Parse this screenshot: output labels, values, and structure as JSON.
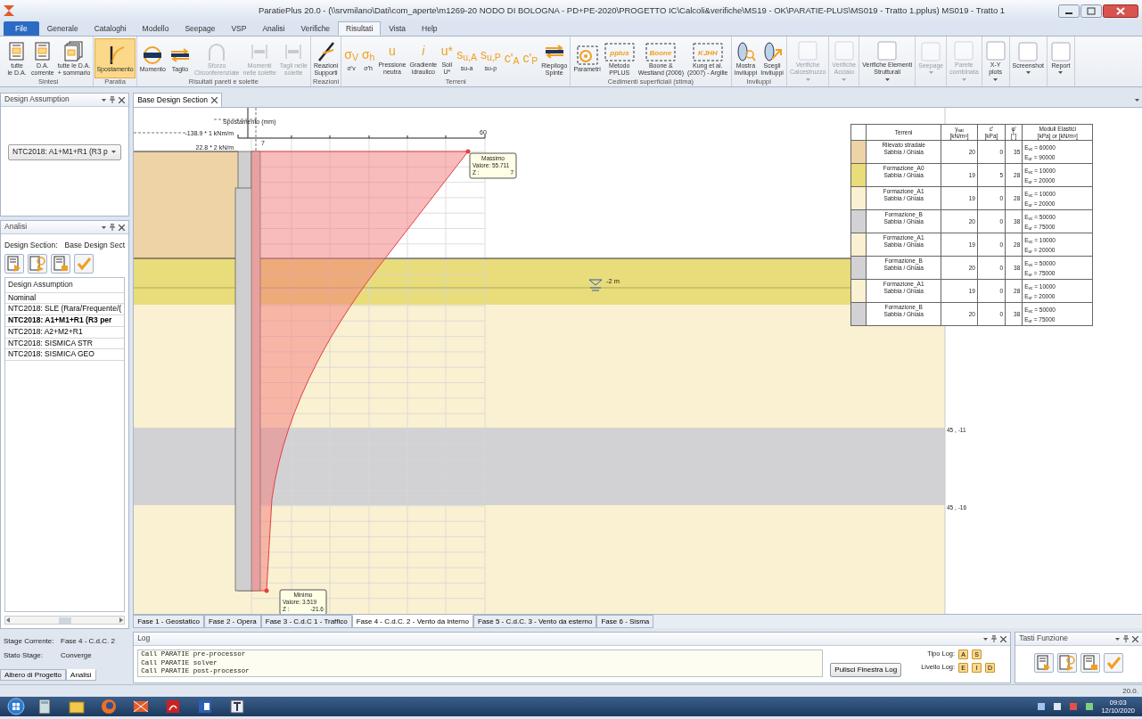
{
  "window": {
    "title": "ParatiePlus 20.0 - (\\\\srvmilano\\Dati\\com_aperte\\m1269-20 NODO DI BOLOGNA - PD+PE-2020\\PROGETTO IC\\Calcoli&verifiche\\MS19 - OK\\PARATIE-PLUS\\MS019 - Tratto 1.pplus) MS019 - Tratto 1"
  },
  "menu_tabs": [
    {
      "label": "File",
      "kind": "file",
      "selected": false
    },
    {
      "label": "Generale",
      "kind": "tab",
      "selected": false
    },
    {
      "label": "Cataloghi",
      "kind": "tab",
      "selected": false
    },
    {
      "label": "Modello",
      "kind": "tab",
      "selected": false
    },
    {
      "label": "Seepage",
      "kind": "tab",
      "selected": false
    },
    {
      "label": "VSP",
      "kind": "tab",
      "selected": false
    },
    {
      "label": "Analisi",
      "kind": "tab",
      "selected": false
    },
    {
      "label": "Verifiche",
      "kind": "tab",
      "selected": false
    },
    {
      "label": "Risultati",
      "kind": "tab",
      "selected": true
    },
    {
      "label": "Vista",
      "kind": "tab",
      "selected": false
    },
    {
      "label": "Help",
      "kind": "tab",
      "selected": false
    }
  ],
  "ribbon": {
    "groups": [
      {
        "label": "Sintesi",
        "buttons": [
          {
            "label": "tutte\nle D.A.",
            "kind": "icon",
            "selected": false,
            "disabled": false
          },
          {
            "label": "D.A.\ncorrente",
            "kind": "icon",
            "selected": false,
            "disabled": false
          },
          {
            "label": "tutte le D.A.\n+ sommario",
            "kind": "icon",
            "selected": false,
            "disabled": false
          }
        ]
      },
      {
        "label": "Paratia",
        "buttons": [
          {
            "label": "Spostamento",
            "kind": "icon",
            "selected": true,
            "disabled": false
          }
        ]
      },
      {
        "label": "Risultati pareti e solette",
        "buttons": [
          {
            "label": "Momento",
            "kind": "icon",
            "selected": false,
            "disabled": false
          },
          {
            "label": "Taglio",
            "kind": "icon",
            "selected": false,
            "disabled": false
          },
          {
            "label": "Sforzo\nCirconferenziale",
            "kind": "icon",
            "selected": false,
            "disabled": true
          },
          {
            "label": "Momenti\nnelle solette",
            "kind": "icon",
            "selected": false,
            "disabled": true
          },
          {
            "label": "Tagli nelle\nsolette",
            "kind": "icon",
            "selected": false,
            "disabled": true
          }
        ]
      },
      {
        "label": "Reazioni",
        "buttons": [
          {
            "label": "Reazioni\nSupporti",
            "kind": "icon",
            "selected": false,
            "disabled": false
          }
        ]
      },
      {
        "label": "Terreni",
        "buttons": [
          {
            "label": "σ'v",
            "kind": "glyph",
            "glyph": "σ$_{V}$",
            "selected": false,
            "disabled": false
          },
          {
            "label": "σ'h",
            "kind": "glyph",
            "glyph": "σ$_{h}$",
            "selected": false,
            "disabled": false
          },
          {
            "label": "Pressione\nneutra",
            "kind": "glyph",
            "glyph": "u",
            "selected": false,
            "disabled": false
          },
          {
            "label": "Gradiente\nidraulico",
            "kind": "glyph",
            "glyph": "*i*",
            "selected": false,
            "disabled": false
          },
          {
            "label": "Soil\nU*",
            "kind": "glyph",
            "glyph": "u*",
            "selected": false,
            "disabled": false
          },
          {
            "label": "su-a",
            "kind": "glyph",
            "glyph": "s$_{u,A}$",
            "selected": false,
            "disabled": false
          },
          {
            "label": "su-p",
            "kind": "glyph",
            "glyph": "s$_{u,P}$",
            "selected": false,
            "disabled": false
          },
          {
            "kind": "glyph",
            "glyph": "c'$_{A}$",
            "selected": false,
            "disabled": false
          },
          {
            "kind": "glyph",
            "glyph": "c'$_{P}$",
            "selected": false,
            "disabled": false
          },
          {
            "label": "Riepilogo\nSpinte",
            "kind": "icon",
            "selected": false,
            "disabled": false
          }
        ]
      },
      {
        "label": "Cedimenti superficiali (stima)",
        "buttons": [
          {
            "label": "Parametri",
            "kind": "icon",
            "selected": false,
            "disabled": false
          },
          {
            "label": "Metodo\nPPLUS",
            "kind": "logo",
            "icon_text": "pplus",
            "selected": false,
            "disabled": false
          },
          {
            "label": "Boone &\nWestland (2006)",
            "kind": "logo",
            "icon_text": "Boone",
            "selected": false,
            "disabled": false
          },
          {
            "label": "Kung et al.\n(2007) - Argille",
            "kind": "logo",
            "icon_text": "KJHH",
            "selected": false,
            "disabled": false
          }
        ]
      },
      {
        "label": "Inviluppi",
        "buttons": [
          {
            "label": "Mostra\nInviluppi",
            "kind": "icon",
            "selected": false,
            "disabled": false
          },
          {
            "label": "Scegli\nInviluppi",
            "kind": "icon",
            "selected": false,
            "disabled": false
          }
        ]
      },
      {
        "buttons": [
          {
            "label": "Verifiche\nCalcestruzzo",
            "kind": "icon",
            "dropdown": true,
            "selected": false,
            "disabled": true
          }
        ]
      },
      {
        "buttons": [
          {
            "label": "Verifiche\nAcciaio",
            "kind": "icon",
            "dropdown": true,
            "selected": false,
            "disabled": true
          }
        ]
      },
      {
        "buttons": [
          {
            "label": "Verifiche Elementi\nStrutturali",
            "kind": "icon",
            "dropdown": true,
            "selected": false,
            "disabled": false
          }
        ]
      },
      {
        "buttons": [
          {
            "label": "Seepage",
            "kind": "icon",
            "dropdown": true,
            "selected": false,
            "disabled": true
          }
        ]
      },
      {
        "buttons": [
          {
            "label": "Parete\ncombinata",
            "kind": "icon",
            "dropdown": true,
            "selected": false,
            "disabled": true
          }
        ]
      },
      {
        "buttons": [
          {
            "label": "X-Y\nplots",
            "kind": "icon",
            "dropdown": true,
            "selected": false,
            "disabled": false
          }
        ]
      },
      {
        "buttons": [
          {
            "label": "Screenshot",
            "kind": "icon",
            "dropdown": true,
            "selected": false,
            "disabled": false
          }
        ]
      },
      {
        "buttons": [
          {
            "label": "Report",
            "kind": "icon",
            "dropdown": true,
            "selected": false,
            "disabled": false
          }
        ]
      }
    ]
  },
  "design_assumption_panel": {
    "title": "Design Assumption",
    "dropdown": "NTC2018: A1+M1+R1 (R3 p"
  },
  "analysis_panel": {
    "title": "Analisi",
    "section_label": "Design Section:",
    "section_value": "Base Design Sect",
    "list_header": "Design Assumption",
    "items": [
      {
        "label": "Nominal",
        "selected": false
      },
      {
        "label": "NTC2018: SLE (Rara/Frequente/(",
        "selected": false
      },
      {
        "label": "NTC2018: A1+M1+R1 (R3 per",
        "selected": true
      },
      {
        "label": "NTC2018: A2+M2+R1",
        "selected": false
      },
      {
        "label": "NTC2018: SISMICA STR",
        "selected": false
      },
      {
        "label": "NTC2018: SISMICA GEO",
        "selected": false
      }
    ]
  },
  "stage": {
    "current_label": "Stage Corrente:",
    "current_value": "Fase 4 - C.d.C. 2",
    "state_label": "Stato Stage:",
    "state_value": "Converge"
  },
  "left_tabs": [
    {
      "label": "Albero di Progetto",
      "selected": false
    },
    {
      "label": "Analisi",
      "selected": true
    }
  ],
  "document": {
    "tabs": [
      {
        "label": "Base Design Section",
        "selected": true
      }
    ],
    "drawing": {
      "axis_title": "Spostamento (mm)",
      "moment_label": "-138.9 * 1 kNm/m",
      "force_label": "22.8 * 2 kN/m",
      "tick_label": "60",
      "top_value": "7",
      "max_box": {
        "title": "Massimo",
        "value": "Valore: 55.711",
        "z_label": "Z :",
        "z_value": "7"
      },
      "min_box": {
        "title": "Minimo",
        "value": "Valore: 3.519",
        "z_label": "Z :",
        "z_value": "-21.6"
      },
      "water_level": "-2 m",
      "coordinates": [
        "45 , -11",
        "45 , -16"
      ]
    },
    "legend": {
      "columns": [
        {
          "title": "Terreni"
        },
        {
          "title": "γ$_{sat}$",
          "unit": "[kN/m³]"
        },
        {
          "title": "c'",
          "unit": "[kPa]"
        },
        {
          "title": "φ'",
          "unit": "[°]"
        },
        {
          "title": "Moduli Elastici",
          "unit": "[kPa] or [kN/m³]"
        }
      ],
      "rows": [
        {
          "name": "Rilevato stradale",
          "type": "Sabbia / Ghiaia",
          "color": "#eed3a6",
          "gamma": "20",
          "c": "0",
          "phi": "35",
          "evc": "E$_{vc}$ = 60000",
          "eur": "E$_{ur}$ = 90000"
        },
        {
          "name": "Formazione_A0",
          "type": "Sabbia / Ghiaia",
          "color": "#e9dc7a",
          "gamma": "19",
          "c": "5",
          "phi": "28",
          "evc": "E$_{vc}$ = 10000",
          "eur": "E$_{ur}$ = 20000"
        },
        {
          "name": "Formazione_A1",
          "type": "Sabbia / Ghiaia",
          "color": "#faf1d2",
          "gamma": "19",
          "c": "0",
          "phi": "28",
          "evc": "E$_{vc}$ = 10000",
          "eur": "E$_{ur}$ = 20000"
        },
        {
          "name": "Formazione_B",
          "type": "Sabbia / Ghiaia",
          "color": "#d2d2d4",
          "gamma": "20",
          "c": "0",
          "phi": "38",
          "evc": "E$_{vc}$ = 50000",
          "eur": "E$_{ur}$ = 75000"
        },
        {
          "name": "Formazione_A1",
          "type": "Sabbia / Ghiaia",
          "color": "#faf1d2",
          "gamma": "19",
          "c": "0",
          "phi": "28",
          "evc": "E$_{vc}$ = 10000",
          "eur": "E$_{ur}$ = 20000"
        },
        {
          "name": "Formazione_B",
          "type": "Sabbia / Ghiaia",
          "color": "#d2d2d4",
          "gamma": "20",
          "c": "0",
          "phi": "38",
          "evc": "E$_{vc}$ = 50000",
          "eur": "E$_{ur}$ = 75000"
        },
        {
          "name": "Formazione_A1",
          "type": "Sabbia / Ghiaia",
          "color": "#faf1d2",
          "gamma": "19",
          "c": "0",
          "phi": "28",
          "evc": "E$_{vc}$ = 10000",
          "eur": "E$_{ur}$ = 20000"
        },
        {
          "name": "Formazione_B",
          "type": "Sabbia / Ghiaia",
          "color": "#d2d2d4",
          "gamma": "20",
          "c": "0",
          "phi": "38",
          "evc": "E$_{vc}$ = 50000",
          "eur": "E$_{ur}$ = 75000"
        }
      ]
    },
    "phase_tabs": [
      {
        "label": "Fase 1 - Geostatico",
        "selected": false
      },
      {
        "label": "Fase 2 - Opera",
        "selected": false
      },
      {
        "label": "Fase 3 - C.d.C 1 - Traffico",
        "selected": false
      },
      {
        "label": "Fase 4 - C.d.C. 2 - Vento da interno",
        "selected": true
      },
      {
        "label": "Fase 5 - C.d.C. 3 - Vento da esterno",
        "selected": false
      },
      {
        "label": "Fase 6 - Sisma",
        "selected": false
      }
    ]
  },
  "log": {
    "title": "Log",
    "lines": [
      "Call PARATIE pre-processor",
      "Call PARATIE solver",
      "Call PARATIE post-processor"
    ],
    "clear_button": "Pulisci Finestra Log",
    "type_label": "Tipo Log:",
    "type_buttons": [
      "A",
      "S"
    ],
    "level_label": "Livello Log:",
    "level_buttons": [
      "E",
      "I",
      "D"
    ]
  },
  "function_keys": {
    "title": "Tasti Funzione"
  },
  "status_bar": {
    "version": "20.0."
  },
  "taskbar": {
    "time": "09:03",
    "date": "12/10/2020"
  }
}
